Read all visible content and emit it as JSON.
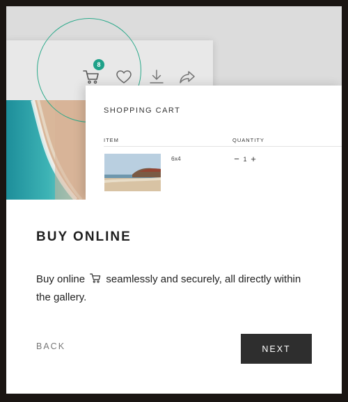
{
  "illustration": {
    "toolbar": {
      "cart_badge": "8",
      "icons": [
        "cart-icon",
        "heart-icon",
        "download-icon",
        "share-icon"
      ]
    },
    "cart": {
      "title": "SHOPPING CART",
      "columns": {
        "item": "ITEM",
        "quantity": "QUANTITY"
      },
      "row": {
        "size": "6x4",
        "quantity": "1",
        "minus": "−",
        "plus": "+"
      }
    },
    "accent_color": "#2aa98a"
  },
  "content": {
    "heading": "BUY ONLINE",
    "body_before": "Buy online",
    "body_after": " seamlessly and securely, all directly within the gallery."
  },
  "actions": {
    "back_label": "BACK",
    "next_label": "NEXT"
  }
}
